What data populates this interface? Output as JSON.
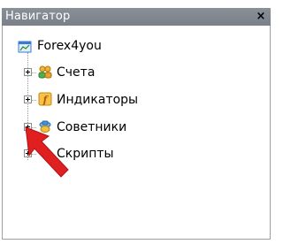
{
  "window": {
    "title": "Навигатор",
    "close_glyph": "×"
  },
  "tree": {
    "root": {
      "label": "Forex4you",
      "icon": "terminal-icon"
    },
    "items": [
      {
        "label": "Счета",
        "icon": "accounts-icon"
      },
      {
        "label": "Индикаторы",
        "icon": "indicators-icon"
      },
      {
        "label": "Советники",
        "icon": "experts-icon"
      },
      {
        "label": "Скрипты",
        "icon": "scripts-icon"
      }
    ]
  },
  "annotation": {
    "icon": "red-arrow-icon",
    "color": "#e02020"
  }
}
